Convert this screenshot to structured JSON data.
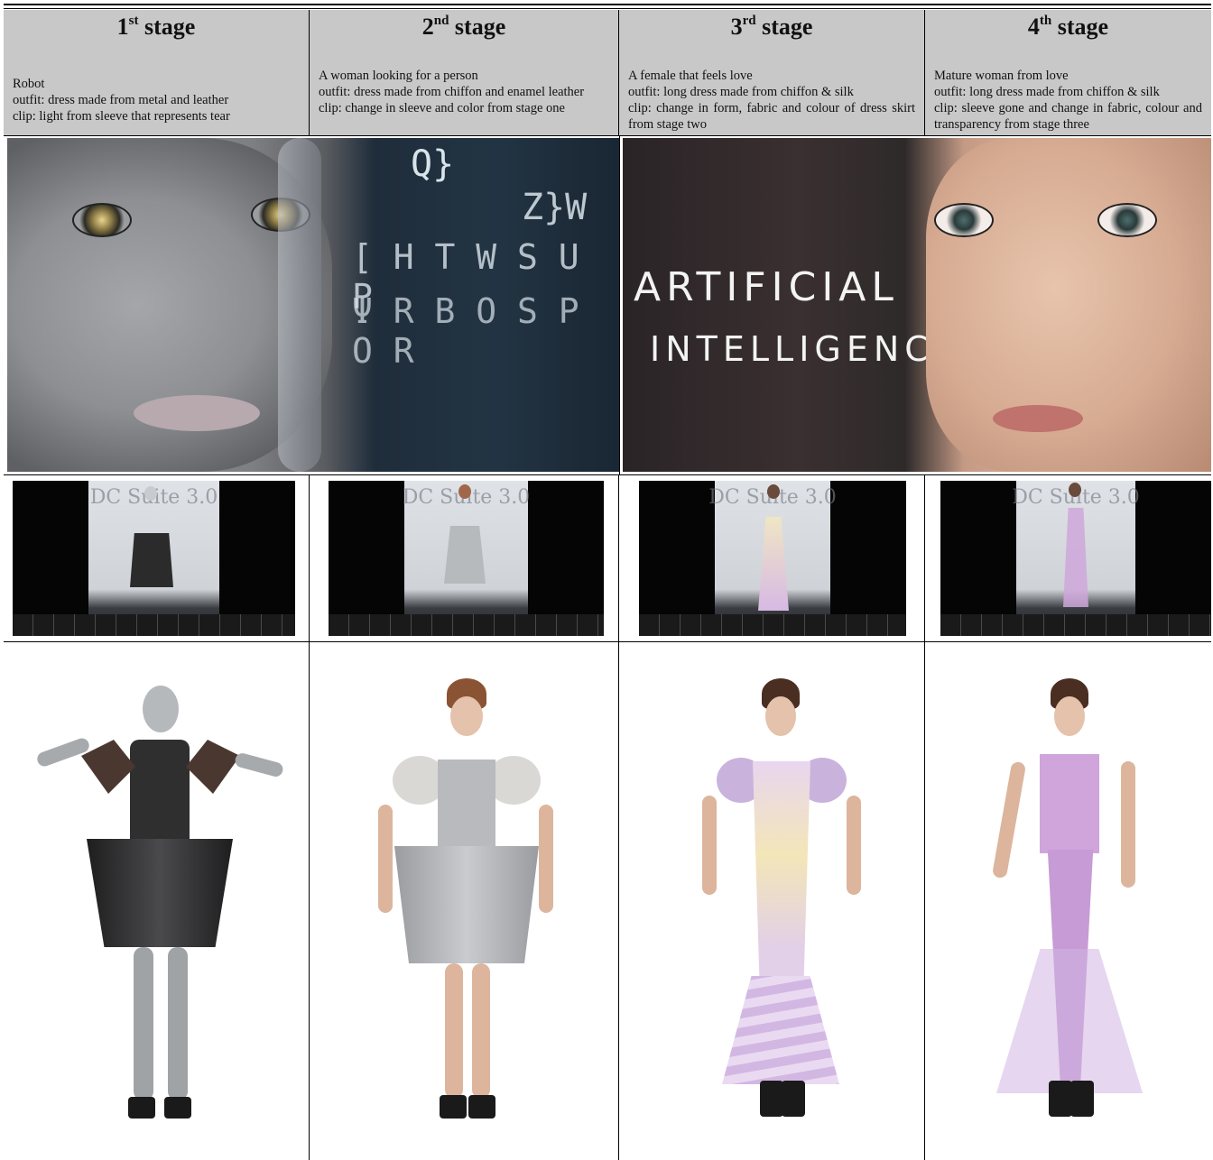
{
  "stages": [
    {
      "num": "1",
      "sup": "st",
      "word": "stage",
      "lines": [
        "Robot",
        "outfit: dress made from metal and leather",
        "clip: light from sleeve that represents tear"
      ]
    },
    {
      "num": "2",
      "sup": "nd",
      "word": "stage",
      "lines": [
        "A woman looking for a person",
        "outfit: dress made from chiffon and enamel leather",
        "clip: change in sleeve and color from stage one"
      ]
    },
    {
      "num": "3",
      "sup": "rd",
      "word": "stage",
      "lines": [
        "A female that feels love",
        "outfit: long dress made from chiffon & silk",
        "clip: change in form, fabric and colour of dress skirt from stage two"
      ]
    },
    {
      "num": "4",
      "sup": "th",
      "word": "stage",
      "lines": [
        "Mature woman from love",
        "outfit: long dress made from chiffon & silk",
        "clip: sleeve gone and change in fabric, colour and transparency from stage three"
      ]
    }
  ],
  "banner_left": {
    "glyph_rows": [
      "Q}",
      "Z}W",
      "[ H T W  S U P",
      "Ψ R B O S P O R"
    ]
  },
  "banner_right": {
    "line1": "ARTIFICIAL",
    "line2": "INTELLIGENCE"
  },
  "runway_brand": "DC Suite 3.0",
  "colors": {
    "header_bg": "#c8c8c8",
    "stage1_dress": "#2a2a2a",
    "stage2_dress": "#b9bbbe",
    "stage3_dress": "#e6d7ef",
    "stage4_dress": "#d8b8e0"
  }
}
